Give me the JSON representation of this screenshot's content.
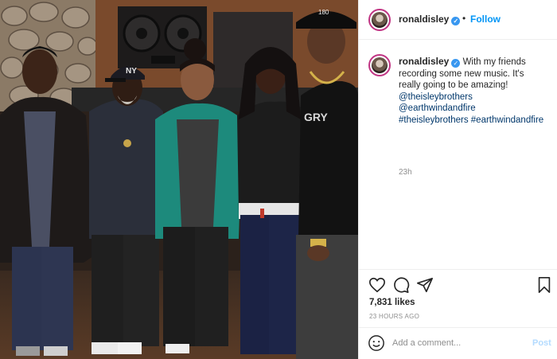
{
  "post": {
    "username": "ronaldisley",
    "verified_icon": "verified-badge-icon",
    "follow_label": "Follow",
    "separator": "•",
    "caption_text": "With my friends recording some new music. It's really going to be amazing!",
    "caption_tags": [
      "@theisleybrothers",
      "@earthwindandfire",
      "#theisleybrothers",
      "#earthwindandfire"
    ],
    "caption_time": "23h",
    "likes": "7,831 likes",
    "time_ago": "23 HOURS AGO",
    "comment_placeholder": "Add a comment...",
    "post_label": "Post"
  },
  "icons": {
    "like": "heart-icon",
    "comment": "comment-icon",
    "share": "share-icon",
    "save": "bookmark-icon",
    "emoji": "emoji-icon"
  },
  "colors": {
    "link_blue": "#0095f6",
    "tag_blue": "#00376b",
    "post_disabled": "#b3dbff",
    "muted": "#8e8e8e",
    "verified": "#3897f0"
  }
}
